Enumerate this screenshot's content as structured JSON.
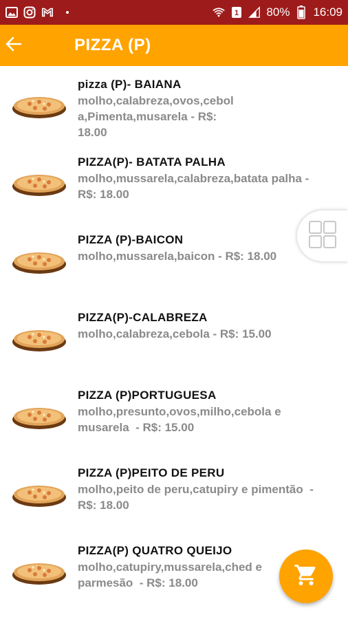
{
  "status_bar": {
    "battery": "80%",
    "time": "16:09",
    "icons": [
      "image-icon",
      "instagram-icon",
      "gmail-icon",
      "dot-icon",
      "wifi-icon",
      "sim-icon",
      "signal-icon",
      "battery-icon"
    ]
  },
  "app_bar": {
    "title": "PIZZA (P)",
    "back_icon": "arrow-back-icon"
  },
  "items": [
    {
      "name": "pizza (P)- BAIANA",
      "desc_lines": [
        "molho,calabreza,ovos,cebol",
        "a,Pimenta,musarela - R$:",
        "18.00"
      ]
    },
    {
      "name": "PIZZA(P)- BATATA PALHA",
      "desc_lines": [
        "molho,mussarela,calabreza,batata palha -",
        "R$: 18.00"
      ]
    },
    {
      "name": "PIZZA (P)-BAICON",
      "desc_lines": [
        "molho,mussarela,baicon - R$: 18.00"
      ]
    },
    {
      "name": "PIZZA(P)-CALABREZA",
      "desc_lines": [
        "molho,calabreza,cebola - R$: 15.00"
      ]
    },
    {
      "name": "PIZZA (P)PORTUGUESA",
      "desc_lines": [
        "molho,presunto,ovos,milho,cebola e",
        "musarela  - R$: 15.00"
      ]
    },
    {
      "name": "PIZZA (P)PEITO DE PERU",
      "desc_lines": [
        "molho,peito de peru,catupiry e pimentão  -",
        "R$: 18.00"
      ]
    },
    {
      "name": "PIZZA(P) QUATRO QUEIJO",
      "desc_lines": [
        "molho,catupiry,mussarela,ched e",
        "parmesão  - R$: 18.00"
      ]
    }
  ],
  "grid_toggle_icon": "grid-view-icon",
  "cart_icon": "shopping-cart-icon",
  "colors": {
    "status_bar": "#9e1b1b",
    "accent": "#ffa300",
    "name_text": "#111111",
    "desc_text": "#8a8a8a"
  }
}
